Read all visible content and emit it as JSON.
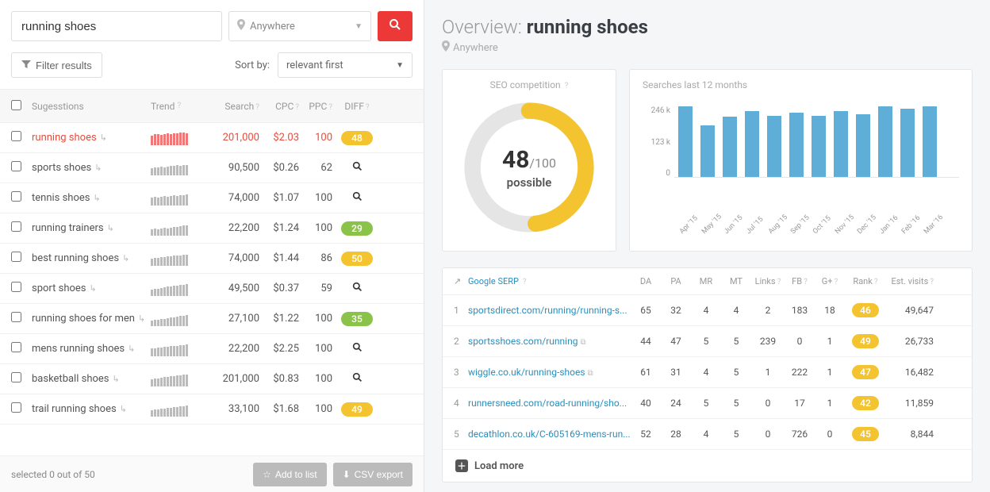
{
  "search": {
    "query": "running shoes",
    "location": "Anywhere",
    "placeholder": ""
  },
  "filter_label": "Filter results",
  "sort": {
    "label": "Sort by:",
    "selected": "relevant first"
  },
  "columns": {
    "name": "Sugesstions",
    "trend": "Trend",
    "search": "Search",
    "cpc": "CPC",
    "ppc": "PPC",
    "diff": "DIFF"
  },
  "suggestions": [
    {
      "name": "running shoes",
      "trend": [
        12,
        14,
        14,
        13,
        14,
        15,
        14,
        15,
        15,
        16,
        16,
        15
      ],
      "search": "201,000",
      "cpc": "$2.03",
      "ppc": "100",
      "diff": "48",
      "active": true,
      "pill": "yellow"
    },
    {
      "name": "sports shoes",
      "trend": [
        9,
        10,
        10,
        11,
        10,
        11,
        12,
        12,
        13,
        12,
        13,
        13
      ],
      "search": "90,500",
      "cpc": "$0.26",
      "ppc": "62",
      "diff": null,
      "active": false
    },
    {
      "name": "tennis shoes",
      "trend": [
        10,
        11,
        10,
        11,
        12,
        11,
        12,
        13,
        12,
        13,
        13,
        14
      ],
      "search": "74,000",
      "cpc": "$1.07",
      "ppc": "100",
      "diff": null,
      "active": false
    },
    {
      "name": "running trainers",
      "trend": [
        8,
        9,
        8,
        9,
        10,
        9,
        10,
        11,
        11,
        12,
        13,
        13
      ],
      "search": "22,200",
      "cpc": "$1.24",
      "ppc": "100",
      "diff": "29",
      "pill": "green",
      "active": false
    },
    {
      "name": "best running shoes",
      "trend": [
        9,
        10,
        10,
        11,
        11,
        12,
        12,
        13,
        13,
        13,
        14,
        14
      ],
      "search": "74,000",
      "cpc": "$1.44",
      "ppc": "86",
      "diff": "50",
      "pill": "yellow",
      "active": false
    },
    {
      "name": "sport shoes",
      "trend": [
        8,
        9,
        9,
        10,
        11,
        12,
        12,
        13,
        13,
        14,
        14,
        15
      ],
      "search": "49,500",
      "cpc": "$0.37",
      "ppc": "59",
      "diff": null,
      "active": false
    },
    {
      "name": "running shoes for men",
      "trend": [
        7,
        8,
        8,
        9,
        9,
        10,
        11,
        11,
        12,
        13,
        13,
        14
      ],
      "search": "27,100",
      "cpc": "$1.22",
      "ppc": "100",
      "diff": "35",
      "pill": "green",
      "active": false
    },
    {
      "name": "mens running shoes",
      "trend": [
        10,
        10,
        11,
        11,
        12,
        12,
        13,
        13,
        13,
        14,
        14,
        15
      ],
      "search": "22,200",
      "cpc": "$2.25",
      "ppc": "100",
      "diff": null,
      "active": false
    },
    {
      "name": "basketball shoes",
      "trend": [
        9,
        10,
        10,
        11,
        12,
        12,
        13,
        13,
        14,
        14,
        15,
        15
      ],
      "search": "201,000",
      "cpc": "$0.83",
      "ppc": "100",
      "diff": null,
      "active": false
    },
    {
      "name": "trail running shoes",
      "trend": [
        8,
        9,
        9,
        10,
        10,
        11,
        11,
        12,
        12,
        13,
        13,
        14
      ],
      "search": "33,100",
      "cpc": "$1.68",
      "ppc": "100",
      "diff": "49",
      "pill": "yellow",
      "active": false
    }
  ],
  "footer": {
    "selected_text": "selected 0 out of 50",
    "add_label": "Add to list",
    "csv_label": "CSV export"
  },
  "overview": {
    "title_prefix": "Overview: ",
    "keyword": "running shoes",
    "location": "Anywhere",
    "seo_label": "SEO competition",
    "seo_score": "48",
    "seo_max": "/100",
    "seo_sub": "possible"
  },
  "chart_data": {
    "type": "bar",
    "title": "Searches last 12 months",
    "categories": [
      "Apr '15",
      "May '15",
      "Jun '15",
      "Jul '15",
      "Aug '15",
      "Sep '15",
      "Oct '15",
      "Nov '15",
      "Dec '15",
      "Jan '16",
      "Feb '16",
      "Mar '16"
    ],
    "values": [
      246000,
      180000,
      210000,
      230000,
      215000,
      225000,
      215000,
      230000,
      220000,
      246000,
      240000,
      246000
    ],
    "yticks": [
      "246 k",
      "123 k",
      "0"
    ],
    "ylim": [
      0,
      250000
    ]
  },
  "serp": {
    "header_label": "Google SERP",
    "columns": {
      "da": "DA",
      "pa": "PA",
      "mr": "MR",
      "mt": "MT",
      "links": "Links",
      "fb": "FB",
      "gp": "G+",
      "rank": "Rank",
      "visits": "Est. visits"
    },
    "rows": [
      {
        "idx": "1",
        "url": "sportsdirect.com/running/running-s...",
        "da": "65",
        "pa": "32",
        "mr": "4",
        "mt": "4",
        "links": "2",
        "fb": "183",
        "gp": "18",
        "rank": "46",
        "visits": "49,647"
      },
      {
        "idx": "2",
        "url": "sportsshoes.com/running",
        "da": "44",
        "pa": "47",
        "mr": "5",
        "mt": "5",
        "links": "239",
        "fb": "0",
        "gp": "1",
        "rank": "49",
        "visits": "26,733",
        "ext": true
      },
      {
        "idx": "3",
        "url": "wiggle.co.uk/running-shoes",
        "da": "61",
        "pa": "31",
        "mr": "4",
        "mt": "5",
        "links": "1",
        "fb": "222",
        "gp": "1",
        "rank": "47",
        "visits": "16,482",
        "ext": true
      },
      {
        "idx": "4",
        "url": "runnersneed.com/road-running/sho...",
        "da": "40",
        "pa": "24",
        "mr": "5",
        "mt": "5",
        "links": "0",
        "fb": "17",
        "gp": "1",
        "rank": "42",
        "visits": "11,859"
      },
      {
        "idx": "5",
        "url": "decathlon.co.uk/C-605169-mens-run...",
        "da": "52",
        "pa": "28",
        "mr": "4",
        "mt": "5",
        "links": "0",
        "fb": "726",
        "gp": "0",
        "rank": "45",
        "visits": "8,844"
      }
    ],
    "load_more": "Load more"
  }
}
